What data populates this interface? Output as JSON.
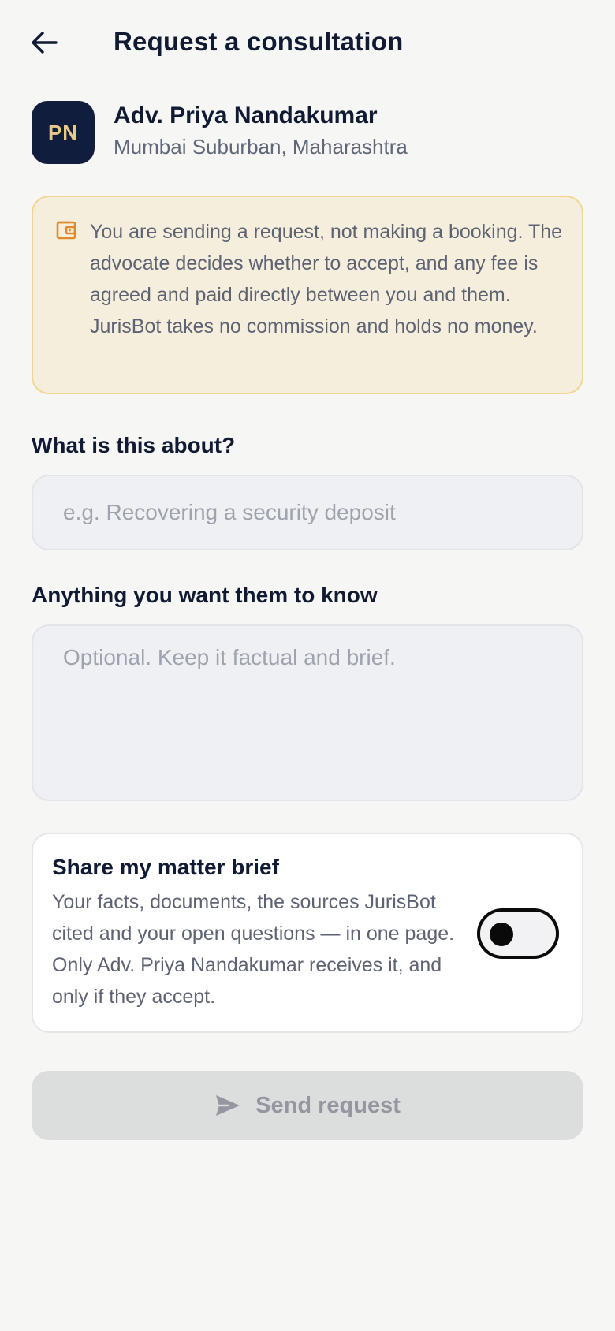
{
  "header": {
    "title": "Request a consultation",
    "back_icon": "arrow-left-icon"
  },
  "advocate": {
    "initials": "PN",
    "name": "Adv. Priya Nandakumar",
    "location": "Mumbai Suburban, Maharashtra",
    "avatar_color": "#111d3d",
    "initials_color": "#e8c98a"
  },
  "notice": {
    "icon": "wallet-icon",
    "text": "You are sending a request, not making a booking. The advocate decides whether to accept, and any fee is agreed and paid directly between you and them. JurisBot takes no commission and holds no money.",
    "bg_color": "#f5eedd",
    "border_color": "#f2d592",
    "icon_color": "#e08a2a"
  },
  "form": {
    "about": {
      "label": "What is this about?",
      "placeholder": "e.g. Recovering a security deposit",
      "value": ""
    },
    "know": {
      "label": "Anything you want them to know",
      "placeholder": "Optional. Keep it factual and brief.",
      "value": ""
    }
  },
  "share": {
    "title": "Share my matter brief",
    "description": "Your facts, documents, the sources JurisBot cited and your open questions — in one page. Only Adv. Priya Nandakumar receives it, and only if they accept.",
    "enabled": false
  },
  "send": {
    "label": "Send request",
    "icon": "send-icon",
    "disabled": true
  }
}
